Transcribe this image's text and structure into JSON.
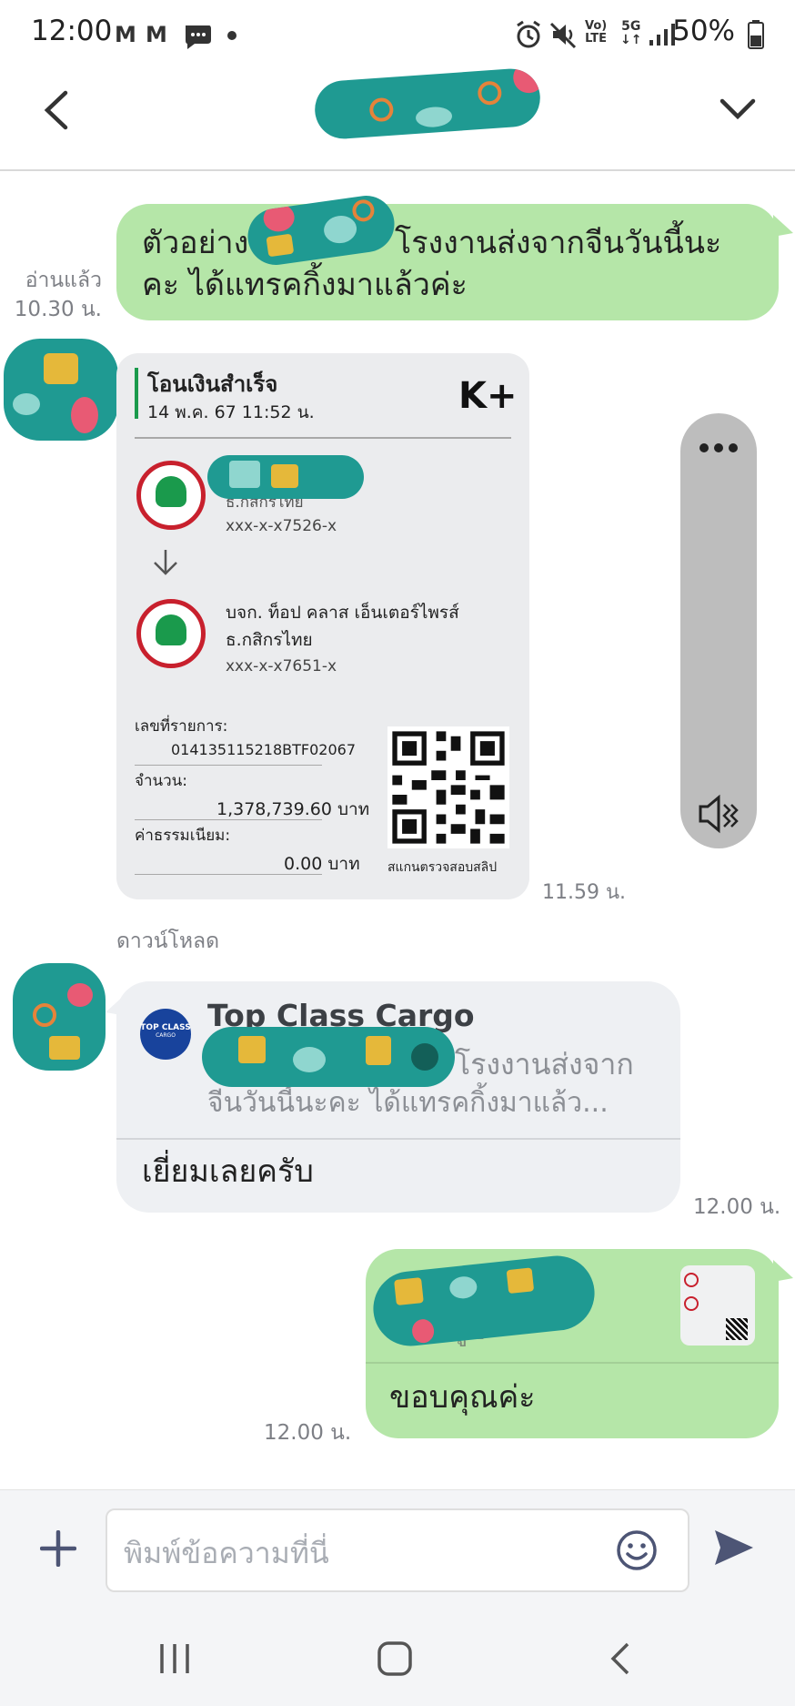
{
  "status_bar": {
    "time": "12:00",
    "battery": "50%",
    "icons": [
      "gmail-icon",
      "gmail-icon",
      "chat-icon",
      "dot-icon",
      "alarm-icon",
      "mute-icon",
      "volte-icon",
      "5g-icon",
      "signal-icon",
      "battery-icon"
    ]
  },
  "header": {
    "icons": [
      "back-icon",
      "chevron-down-icon"
    ]
  },
  "messages": {
    "m1": {
      "text_line1_a": "ตัวอย่าง",
      "text_line1_b": "โรงงานส่งจากจีนวันนี้นะ",
      "text_line2": "คะ ได้แทรคกิ้งมาแล้วค่ะ",
      "read_label": "อ่านแล้ว",
      "time": "10.30 น."
    },
    "slip": {
      "title": "โอนเงินสำเร็จ",
      "date": "14 พ.ค. 67  11:52 น.",
      "brand": "K+",
      "from_bank_partial": "ธ.กสิกรไทย",
      "from_account": "xxx-x-x7526-x",
      "to_name": "บจก. ท็อป คลาส เอ็นเตอร์ไพรส์",
      "to_bank": "ธ.กสิกรไทย",
      "to_account": "xxx-x-x7651-x",
      "ref_label": "เลขที่รายการ:",
      "ref_value": "014135115218BTF02067",
      "amount_label": "จำนวน:",
      "amount_value": "1,378,739.60 บาท",
      "fee_label": "ค่าธรรมเนียม:",
      "fee_value": "0.00 บาท",
      "qr_caption": "สแกนตรวจสอบสลิป",
      "time": "11.59 น.",
      "download_label": "ดาวน์โหลด"
    },
    "reply": {
      "brand_logo_text_1": "TOP CLASS",
      "brand_logo_text_2": "CARGO",
      "quoted_name": "Top Class Cargo",
      "quoted_line1": "โรงงานส่งจาก",
      "quoted_line2": "จีนวันนี้นะคะ ได้แทรคกิ้งมาแล้ว...",
      "text": "เยี่ยมเลยครับ",
      "time": "12.00 น."
    },
    "mine": {
      "quoted_type": "รูป",
      "text": "ขอบคุณค่ะ",
      "time": "12.00 น."
    }
  },
  "input": {
    "placeholder": "พิมพ์ข้อความที่นี่"
  },
  "colors": {
    "bubble_mine": "#b5e6a8",
    "bubble_other": "#eef0f3",
    "send": "#4d5575"
  }
}
